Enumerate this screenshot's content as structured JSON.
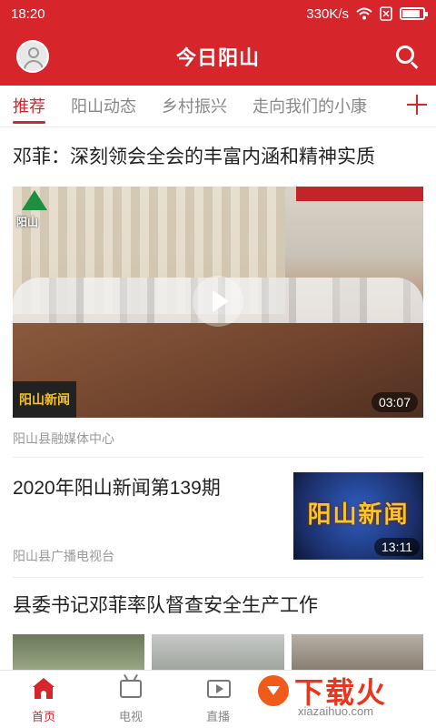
{
  "status_bar": {
    "time": "18:20",
    "speed": "330K/s",
    "icons": [
      "wifi-icon",
      "sim-icon",
      "battery-icon"
    ]
  },
  "header": {
    "title": "今日阳山",
    "background_color": "#d7252c"
  },
  "tabs": {
    "items": [
      "推荐",
      "阳山动态",
      "乡村振兴",
      "走向我们的小康"
    ],
    "active_index": 0,
    "accent_color": "#d7252c"
  },
  "feed": {
    "items": [
      {
        "title": "邓菲：深刻领会全会的丰富内涵和精神实质",
        "video_duration": "03:07",
        "channel_logo_text": "阳山",
        "overlay_text": "阳山新闻",
        "source": "阳山县融媒体中心"
      },
      {
        "title": "2020年阳山新闻第139期",
        "thumb_text": "阳山新闻",
        "video_duration": "13:11",
        "source": "阳山县广播电视台"
      },
      {
        "title": "县委书记邓菲率队督查安全生产工作"
      }
    ]
  },
  "tabbar": {
    "items": [
      {
        "label": "首页",
        "icon": "home-icon"
      },
      {
        "label": "电视",
        "icon": "tv-icon"
      },
      {
        "label": "直播",
        "icon": "live-icon"
      }
    ],
    "active_index": 0
  },
  "watermark": {
    "text": "下载火",
    "url": "xiazaihuo.com"
  }
}
